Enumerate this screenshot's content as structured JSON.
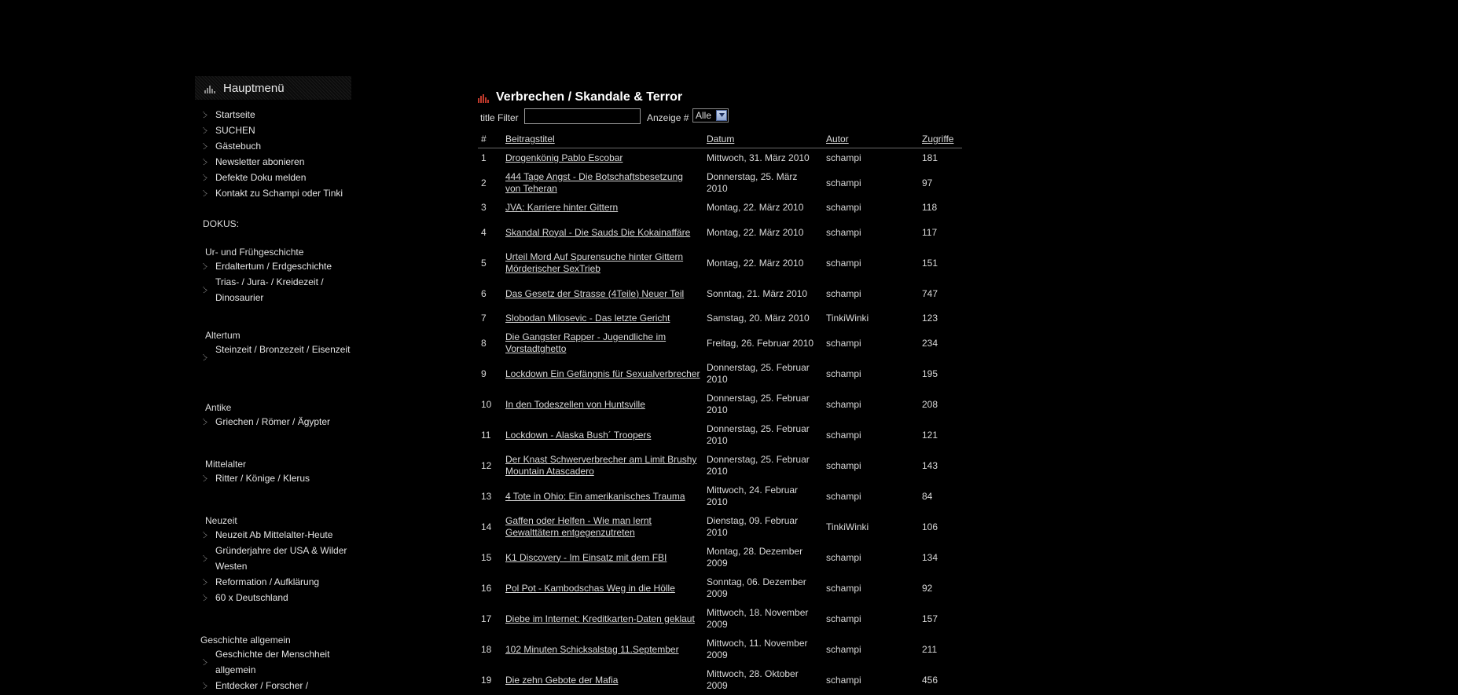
{
  "sidebar": {
    "menu_title": "Hauptmenü",
    "main_items": [
      {
        "label": "Startseite"
      },
      {
        "label": "SUCHEN"
      },
      {
        "label": "Gästebuch"
      },
      {
        "label": "Newsletter abonieren"
      },
      {
        "label": "Defekte Doku melden"
      },
      {
        "label": "Kontakt zu Schampi oder Tinki"
      }
    ],
    "dokus_label": "DOKUS:",
    "sections": [
      {
        "title": "Ur- und Frühgeschichte",
        "items": [
          {
            "label": "Erdaltertum / Erdgeschichte"
          },
          {
            "label": "Trias- / Jura- / Kreidezeit / Dinosaurier"
          }
        ]
      },
      {
        "title": "Altertum",
        "items": [
          {
            "label": "Steinzeit / Bronzezeit / Eisenzeit"
          }
        ]
      },
      {
        "title": "Antike",
        "items": [
          {
            "label": "Griechen / Römer / Ägypter"
          }
        ]
      },
      {
        "title": "Mittelalter",
        "items": [
          {
            "label": "Ritter / Könige / Klerus"
          }
        ]
      },
      {
        "title": "Neuzeit",
        "items": [
          {
            "label": "Neuzeit Ab Mittelalter-Heute"
          },
          {
            "label": "Gründerjahre der USA & Wilder Westen"
          },
          {
            "label": "Reformation / Aufklärung"
          },
          {
            "label": "60 x Deutschland"
          }
        ]
      },
      {
        "title": "Geschichte allgemein",
        "items": [
          {
            "label": "Geschichte der Menschheit allgemein"
          },
          {
            "label": "Entdecker / Forscher /"
          }
        ]
      }
    ]
  },
  "content": {
    "heading": "Verbrechen / Skandale & Terror",
    "filter_label": "title Filter",
    "filter_value": "",
    "display_label": "Anzeige #",
    "display_value": "Alle",
    "columns": {
      "num": "#",
      "title": "Beitragstitel",
      "date": "Datum",
      "author": "Autor",
      "hits": "Zugriffe"
    },
    "rows": [
      {
        "num": "1",
        "title": "Drogenkönig Pablo Escobar",
        "date": "Mittwoch, 31. März 2010",
        "author": "schampi",
        "hits": "181"
      },
      {
        "num": "2",
        "title": "444 Tage Angst - Die Botschaftsbesetzung von Teheran",
        "date": "Donnerstag, 25. März 2010",
        "author": "schampi",
        "hits": "97"
      },
      {
        "num": "3",
        "title": "JVA: Karriere hinter Gittern",
        "date": "Montag, 22. März 2010",
        "author": "schampi",
        "hits": "118"
      },
      {
        "num": "4",
        "title": "Skandal Royal - Die Sauds Die Kokainaffäre",
        "date": "Montag, 22. März 2010",
        "author": "schampi",
        "hits": "117"
      },
      {
        "num": "5",
        "title": "Urteil Mord Auf Spurensuche hinter Gittern Mörderischer SexTrieb",
        "date": "Montag, 22. März 2010",
        "author": "schampi",
        "hits": "151"
      },
      {
        "num": "6",
        "title": "Das Gesetz der Strasse (4Teile) Neuer Teil",
        "date": "Sonntag, 21. März 2010",
        "author": "schampi",
        "hits": "747"
      },
      {
        "num": "7",
        "title": "Slobodan Milosevic - Das letzte Gericht",
        "date": "Samstag, 20. März 2010",
        "author": "TinkiWinki",
        "hits": "123"
      },
      {
        "num": "8",
        "title": "Die Gangster Rapper - Jugendliche im Vorstadtghetto",
        "date": "Freitag, 26. Februar 2010",
        "author": "schampi",
        "hits": "234"
      },
      {
        "num": "9",
        "title": "Lockdown Ein Gefängnis für Sexualverbrecher",
        "date": "Donnerstag, 25. Februar 2010",
        "author": "schampi",
        "hits": "195"
      },
      {
        "num": "10",
        "title": "In den Todeszellen von Huntsville",
        "date": "Donnerstag, 25. Februar 2010",
        "author": "schampi",
        "hits": "208"
      },
      {
        "num": "11",
        "title": "Lockdown - Alaska Bush´ Troopers",
        "date": "Donnerstag, 25. Februar 2010",
        "author": "schampi",
        "hits": "121"
      },
      {
        "num": "12",
        "title": "Der Knast Schwerverbrecher am Limit Brushy Mountain Atascadero",
        "date": "Donnerstag, 25. Februar 2010",
        "author": "schampi",
        "hits": "143"
      },
      {
        "num": "13",
        "title": "4 Tote in Ohio: Ein amerikanisches Trauma",
        "date": "Mittwoch, 24. Februar 2010",
        "author": "schampi",
        "hits": "84"
      },
      {
        "num": "14",
        "title": "Gaffen oder Helfen - Wie man lernt Gewalttätern entgegenzutreten",
        "date": "Dienstag, 09. Februar 2010",
        "author": "TinkiWinki",
        "hits": "106"
      },
      {
        "num": "15",
        "title": "K1 Discovery - Im Einsatz mit dem FBI",
        "date": "Montag, 28. Dezember 2009",
        "author": "schampi",
        "hits": "134"
      },
      {
        "num": "16",
        "title": "Pol Pot - Kambodschas Weg in die Hölle",
        "date": "Sonntag, 06. Dezember 2009",
        "author": "schampi",
        "hits": "92"
      },
      {
        "num": "17",
        "title": "Diebe im Internet: Kreditkarten-Daten geklaut",
        "date": "Mittwoch, 18. November 2009",
        "author": "schampi",
        "hits": "157"
      },
      {
        "num": "18",
        "title": "102 Minuten Schicksalstag 11.September",
        "date": "Mittwoch, 11. November 2009",
        "author": "schampi",
        "hits": "211"
      },
      {
        "num": "19",
        "title": "Die zehn Gebote der Mafia",
        "date": "Mittwoch, 28. Oktober 2009",
        "author": "schampi",
        "hits": "456"
      }
    ]
  },
  "icons": {
    "menu_bullet": "chevron-right-icon",
    "heading": "bar-graph-icon"
  },
  "colors": {
    "background": "#000000",
    "text": "#cfcfcf",
    "accent_bars": "#c0392b"
  }
}
